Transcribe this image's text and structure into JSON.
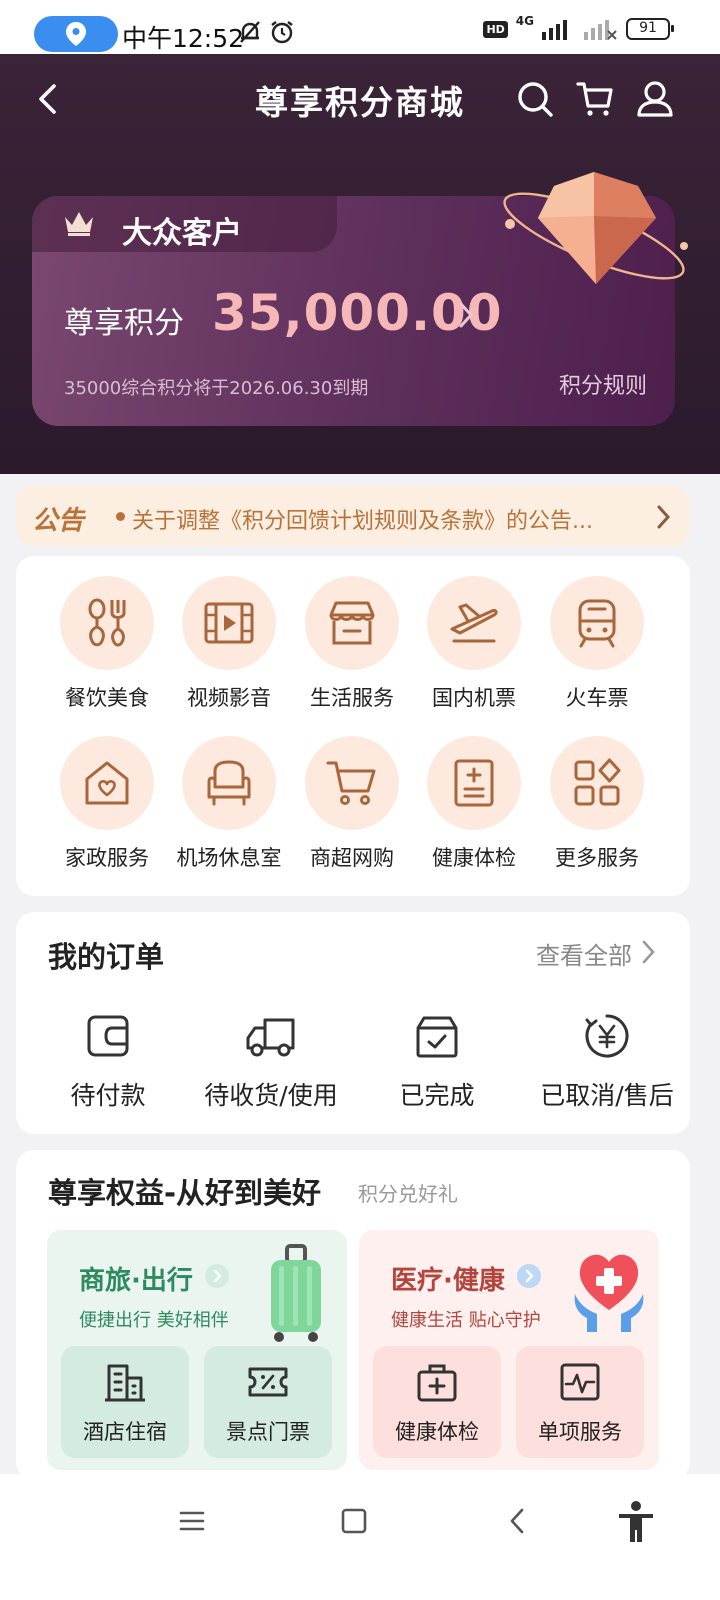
{
  "status_bar": {
    "time": "中午12:52",
    "network": "4G",
    "battery": "91"
  },
  "header": {
    "title": "尊享积分商城"
  },
  "member_card": {
    "tier": "大众客户",
    "points_label": "尊享积分",
    "points_value": "35,000.00",
    "expiry_note": "35000综合积分将于2026.06.30到期",
    "rules_link": "积分规则"
  },
  "notice": {
    "tag": "公告",
    "text": "关于调整《积分回馈计划规则及条款》的公告..."
  },
  "services": [
    {
      "label": "餐饮美食",
      "icon": "dining-icon"
    },
    {
      "label": "视频影音",
      "icon": "video-icon"
    },
    {
      "label": "生活服务",
      "icon": "shop-icon"
    },
    {
      "label": "国内机票",
      "icon": "flight-icon"
    },
    {
      "label": "火车票",
      "icon": "train-icon"
    },
    {
      "label": "家政服务",
      "icon": "home-care-icon"
    },
    {
      "label": "机场休息室",
      "icon": "lounge-chair-icon"
    },
    {
      "label": "商超网购",
      "icon": "cart-icon"
    },
    {
      "label": "健康体检",
      "icon": "health-checkup-icon"
    },
    {
      "label": "更多服务",
      "icon": "more-grid-icon"
    }
  ],
  "orders": {
    "title": "我的订单",
    "view_all": "查看全部",
    "items": [
      {
        "label": "待付款",
        "icon": "wallet-icon"
      },
      {
        "label": "待收货/使用",
        "icon": "truck-icon"
      },
      {
        "label": "已完成",
        "icon": "box-check-icon"
      },
      {
        "label": "已取消/售后",
        "icon": "yuan-refund-icon"
      }
    ]
  },
  "benefits": {
    "title": "尊享权益-从好到美好",
    "subtitle": "积分兑好礼",
    "travel": {
      "title": "商旅·出行",
      "subtitle": "便捷出行 美好相伴",
      "tiles": [
        {
          "label": "酒店住宿",
          "icon": "hotel-icon"
        },
        {
          "label": "景点门票",
          "icon": "ticket-icon"
        }
      ]
    },
    "health": {
      "title": "医疗·健康",
      "subtitle": "健康生活 贴心守护",
      "tiles": [
        {
          "label": "健康体检",
          "icon": "medical-kit-icon"
        },
        {
          "label": "单项服务",
          "icon": "pulse-monitor-icon"
        }
      ]
    }
  },
  "colors": {
    "hero_bg": "#2a1a2c",
    "accent_orange": "#b9733a",
    "points_pink": "#f6b7b7",
    "travel_green": "#2e8a60",
    "health_red": "#b5453c"
  }
}
